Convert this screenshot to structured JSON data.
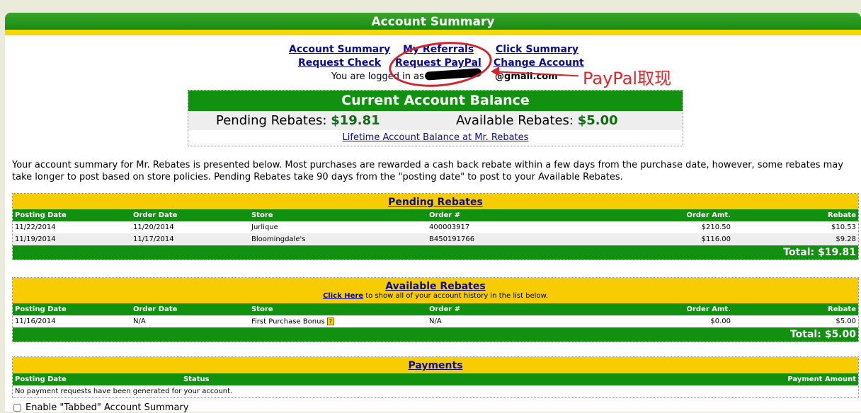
{
  "header": {
    "title": "Account Summary"
  },
  "nav": {
    "account_summary": "Account Summary",
    "my_referrals": "My Referrals",
    "click_summary": "Click Summary",
    "request_check": "Request Check",
    "request_paypal": "Request PayPal",
    "change_account": "Change Account",
    "logged_in": "You are logged in as",
    "email_suffix": "@gmail.com"
  },
  "annotation": {
    "text": "PayPal取现",
    "color": "#e0262b"
  },
  "balance": {
    "title": "Current Account Balance",
    "pending_label": "Pending Rebates:",
    "pending_value": "$19.81",
    "available_label": "Available Rebates:",
    "available_value": "$5.00",
    "lifetime_link": "Lifetime Account Balance at Mr. Rebates"
  },
  "intro": "Your account summary for Mr. Rebates is presented below.  Most purchases are rewarded a cash back rebate within a few days from the purchase date, however, some rebates may take longer to post based on store policies.  Pending Rebates take 90 days from the \"posting date\" to post to your Available Rebates.",
  "pending": {
    "title": "Pending Rebates",
    "columns": [
      "Posting Date",
      "Order Date",
      "Store",
      "Order #",
      "Order Amt.",
      "Rebate"
    ],
    "rows": [
      [
        "11/22/2014",
        "11/20/2014",
        "Jurlique",
        "400003917",
        "$210.50",
        "$10.53"
      ],
      [
        "11/19/2014",
        "11/17/2014",
        "Bloomingdale's",
        "B450191766",
        "$116.00",
        "$9.28"
      ]
    ],
    "total": "Total: $19.81"
  },
  "available": {
    "title": "Available Rebates",
    "click_here": "Click Here",
    "subtitle_rest": " to show all of your account history in the list below.",
    "columns": [
      "Posting Date",
      "Order Date",
      "Store",
      "Order #",
      "Order Amt.",
      "Rebate"
    ],
    "rows": [
      [
        "11/16/2014",
        "N/A",
        "First Purchase Bonus",
        "N/A",
        "$0.00",
        "$5.00"
      ]
    ],
    "total": "Total: $5.00"
  },
  "payments": {
    "title": "Payments",
    "columns": [
      "Posting Date",
      "Status",
      "Payment Amount"
    ],
    "empty": "No payment requests have been generated for your account."
  },
  "enable_tabbed": "Enable \"Tabbed\" Account Summary",
  "colors": {
    "green": "#12900f",
    "yellow": "#f7cc00",
    "link": "#0b0b8e"
  }
}
